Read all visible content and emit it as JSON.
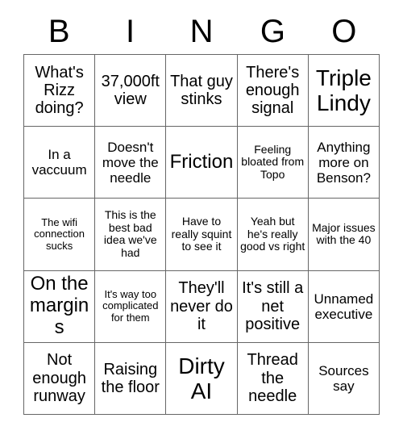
{
  "card": {
    "type": "bingo-card",
    "columns": 5,
    "rows": 5,
    "border_color": "#666666",
    "background_color": "#ffffff",
    "text_color": "#000000"
  },
  "header": {
    "letters": [
      "B",
      "I",
      "N",
      "G",
      "O"
    ]
  },
  "grid": {
    "cells": [
      {
        "text": "What's Rizz doing?",
        "size": "md"
      },
      {
        "text": "37,000ft view",
        "size": "md"
      },
      {
        "text": "That guy stinks",
        "size": "md"
      },
      {
        "text": "There's enough signal",
        "size": "md"
      },
      {
        "text": "Triple Lindy",
        "size": "xl"
      },
      {
        "text": "In a vaccuum",
        "size": "sm"
      },
      {
        "text": "Doesn't move the needle",
        "size": "sm"
      },
      {
        "text": "Friction",
        "size": "lg"
      },
      {
        "text": "Feeling bloated from Topo",
        "size": "xs"
      },
      {
        "text": "Anything more on Benson?",
        "size": "sm"
      },
      {
        "text": "The wifi connection sucks",
        "size": "xxs"
      },
      {
        "text": "This is the best bad idea we've had",
        "size": "xs"
      },
      {
        "text": "Have to really squint to see it",
        "size": "xs"
      },
      {
        "text": "Yeah but he's really good vs right",
        "size": "xs"
      },
      {
        "text": "Major issues with the 40",
        "size": "xs"
      },
      {
        "text": "On the margins",
        "size": "lg"
      },
      {
        "text": "It's way too complicated for them",
        "size": "xxs"
      },
      {
        "text": "They'll never do it",
        "size": "md"
      },
      {
        "text": "It's still a net positive",
        "size": "md"
      },
      {
        "text": "Unnamed executive",
        "size": "sm"
      },
      {
        "text": "Not enough runway",
        "size": "md"
      },
      {
        "text": "Raising the floor",
        "size": "md"
      },
      {
        "text": "Dirty AI",
        "size": "xl"
      },
      {
        "text": "Thread the needle",
        "size": "md"
      },
      {
        "text": "Sources say",
        "size": "sm"
      }
    ]
  }
}
